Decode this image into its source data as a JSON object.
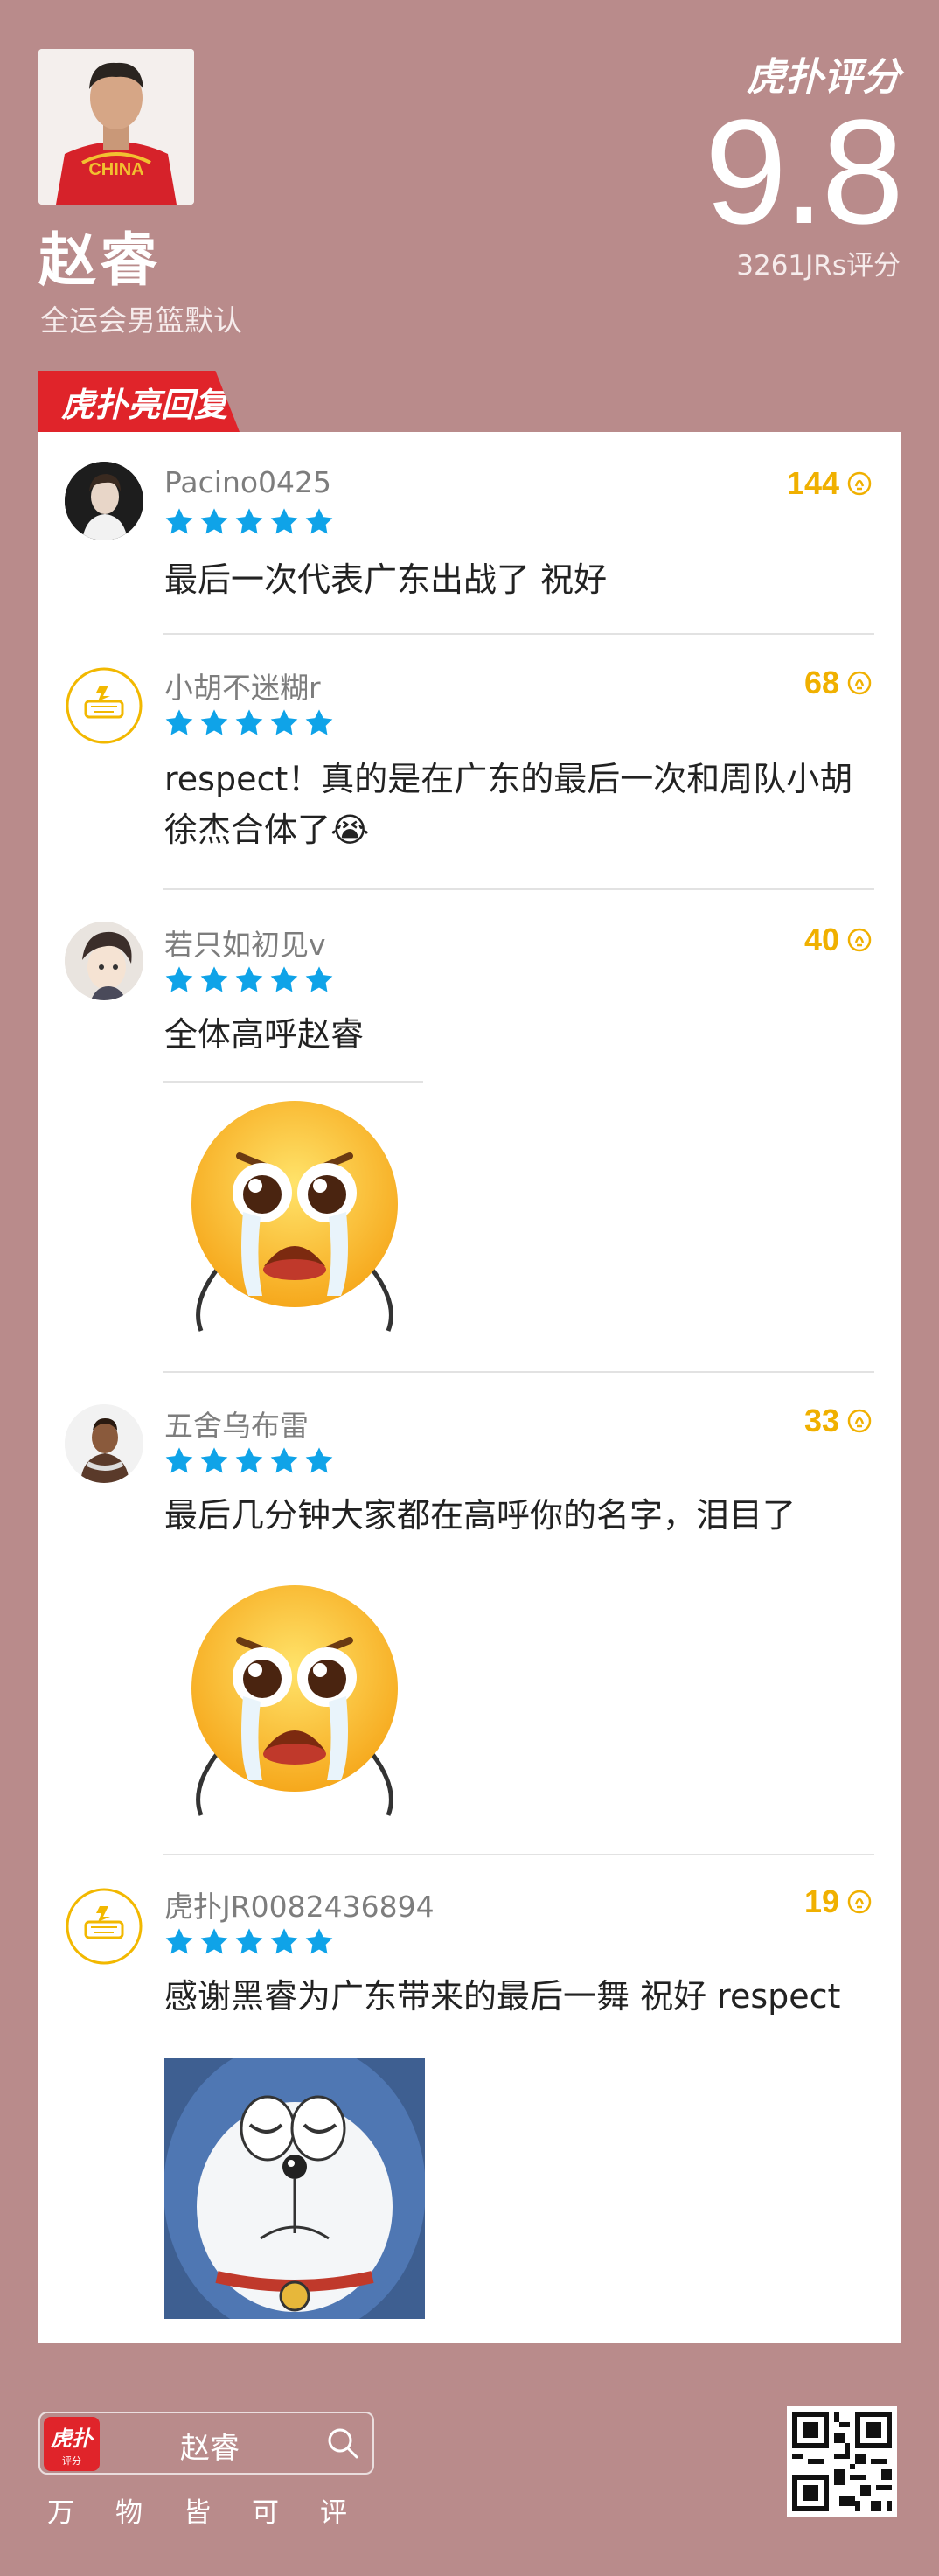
{
  "player": {
    "name": "赵睿",
    "event": "全运会男篮默认",
    "jersey_text": "CHINA"
  },
  "brand": {
    "logo": "虎扑评分",
    "highlight_tag": "虎扑亮回复",
    "accent_color": "#e0242a",
    "background_color": "#b98b8b"
  },
  "score": {
    "value": "9.8",
    "count_text": "3261JRs评分"
  },
  "comments": [
    {
      "user": "Pacino0425",
      "likes": "144",
      "stars": 5,
      "text": "最后一次代表广东出战了 祝好",
      "avatar": "portrait-avatar"
    },
    {
      "user": "小胡不迷糊r",
      "likes": "68",
      "stars": 5,
      "text": "respect！真的是在广东的最后一次和周队小胡徐杰合体了😭",
      "avatar": "default-hupu-avatar"
    },
    {
      "user": "若只如初见v",
      "likes": "40",
      "stars": 5,
      "text": "全体高呼赵睿",
      "avatar": "anime-avatar",
      "image": "crying-emoji-sticker"
    },
    {
      "user": "五舍乌布雷",
      "likes": "33",
      "stars": 5,
      "text": "最后几分钟大家都在高呼你的名字，泪目了",
      "avatar": "player-avatar",
      "image": "crying-emoji-sticker"
    },
    {
      "user": "虎扑JR0082436894",
      "likes": "19",
      "stars": 5,
      "text": "感谢黑睿为广东带来的最后一舞 祝好 respect",
      "avatar": "default-hupu-avatar",
      "image": "crying-doraemon-image"
    }
  ],
  "footer": {
    "search_logo": "虎扑",
    "search_logo_sub": "评分",
    "search_text": "赵睿",
    "slogan": [
      "万",
      "物",
      "皆",
      "可",
      "评"
    ],
    "qr_icon": "qr-code-icon"
  },
  "colors": {
    "star": "#0fa3e8",
    "likes": "#f0b000"
  }
}
